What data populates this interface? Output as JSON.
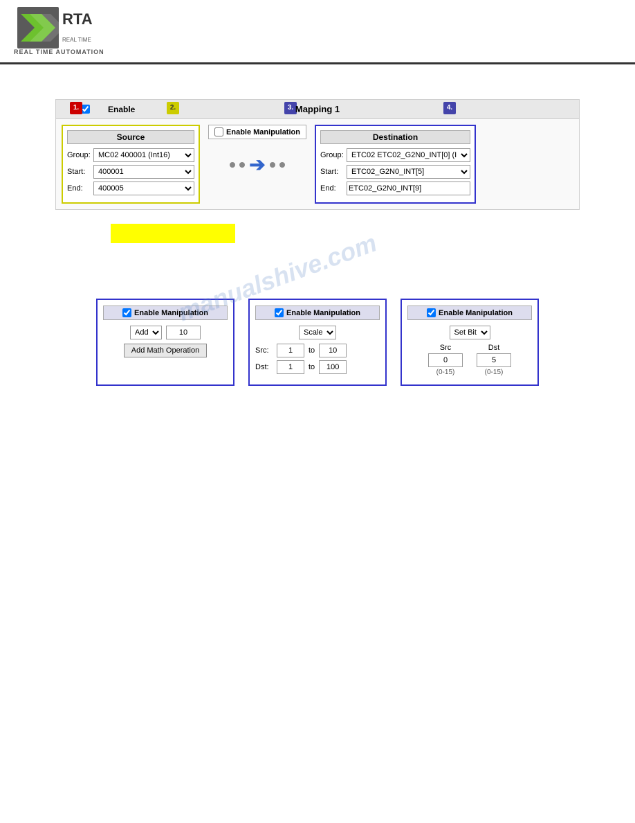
{
  "header": {
    "logo_alt": "RTA Logo",
    "company_name": "REAL TIME AUTOMATION"
  },
  "mapping": {
    "title": "Mapping 1",
    "badge1": "1.",
    "badge2": "2.",
    "badge3": "3.",
    "badge4": "4.",
    "enable_label": "Enable",
    "source": {
      "title": "Source",
      "group_label": "Group:",
      "group_value": "MC02 400001 (Int16)",
      "start_label": "Start:",
      "start_value": "400001",
      "end_label": "End:",
      "end_value": "400005"
    },
    "enable_manipulation_label": "Enable Manipulation",
    "destination": {
      "title": "Destination",
      "group_label": "Group:",
      "group_value": "ETC02 ETC02_G2N0_INT[0] (I",
      "start_label": "Start:",
      "start_value": "ETC02_G2N0_INT[5]",
      "end_label": "End:",
      "end_value": "ETC02_G2N0_INT[9]"
    }
  },
  "watermark": "manualshive.com",
  "bottom_panels": {
    "panel1": {
      "enable_label": "Enable Manipulation",
      "operation_label": "Add",
      "value": "10",
      "button_label": "Add Math Operation"
    },
    "panel2": {
      "enable_label": "Enable Manipulation",
      "type_label": "Scale",
      "src_label": "Src:",
      "src_from": "1",
      "src_to": "10",
      "dst_label": "Dst:",
      "dst_from": "1",
      "dst_to": "100"
    },
    "panel3": {
      "enable_label": "Enable Manipulation",
      "type_label": "Set Bit",
      "src_label": "Src",
      "dst_label": "Dst",
      "src_value": "0",
      "dst_value": "5",
      "src_range": "(0-15)",
      "dst_range": "(0-15)"
    }
  }
}
